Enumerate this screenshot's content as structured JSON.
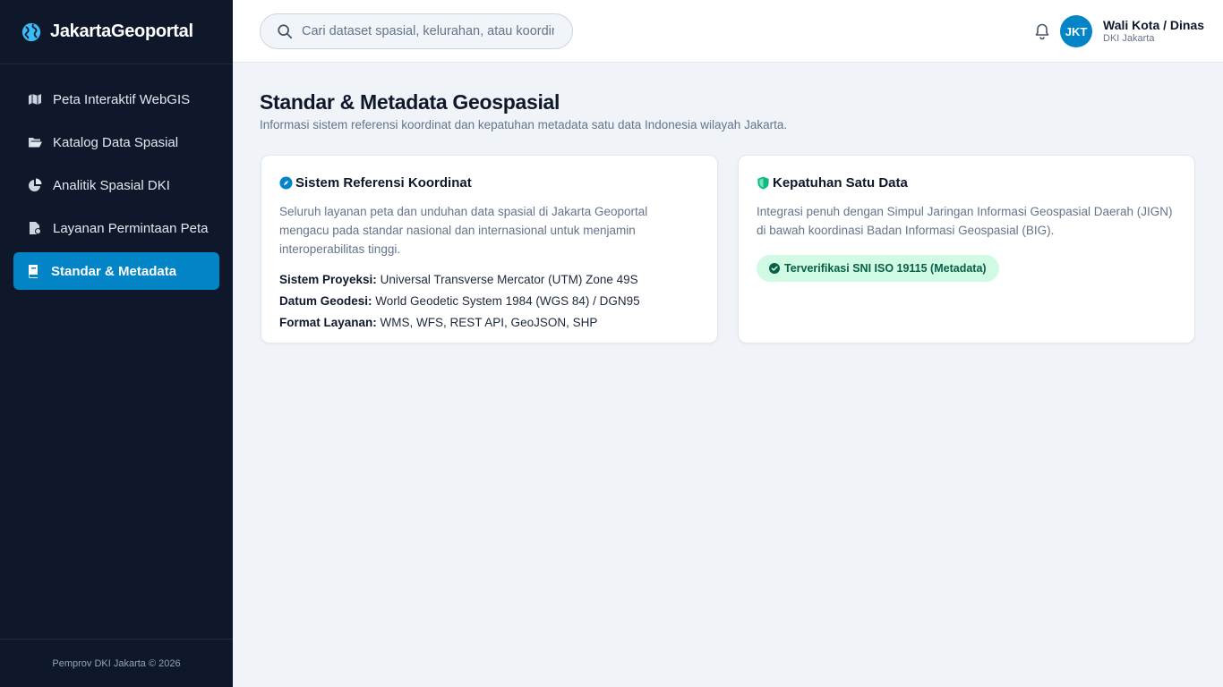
{
  "brand": {
    "name": "JakartaGeoportal",
    "icon": "globe-icon"
  },
  "sidebar": {
    "items": [
      {
        "label": "Peta Interaktif WebGIS",
        "icon": "map-icon",
        "active": false
      },
      {
        "label": "Katalog Data Spasial",
        "icon": "folder-open-icon",
        "active": false
      },
      {
        "label": "Analitik Spasial DKI",
        "icon": "pie-chart-icon",
        "active": false
      },
      {
        "label": "Layanan Permintaan Peta",
        "icon": "file-request-icon",
        "active": false
      },
      {
        "label": "Standar & Metadata",
        "icon": "book-icon",
        "active": true
      }
    ],
    "footer": "Pemprov DKI Jakarta © 2026"
  },
  "header": {
    "search_placeholder": "Cari dataset spasial, kelurahan, atau koordinat...",
    "user": {
      "initials": "JKT",
      "name": "Wali Kota / Dinas",
      "org": "DKI Jakarta"
    }
  },
  "main": {
    "title": "Standar & Metadata Geospasial",
    "subtitle": "Informasi sistem referensi koordinat dan kepatuhan metadata satu data Indonesia wilayah Jakarta.",
    "cards": {
      "crs": {
        "title": "Sistem Referensi Koordinat",
        "icon": "compass-icon",
        "description": "Seluruh layanan peta dan unduhan data spasial di Jakarta Geoportal mengacu pada standar nasional dan internasional untuk menjamin interoperabilitas tinggi.",
        "specs": [
          {
            "key": "Sistem Proyeksi:",
            "value": "Universal Transverse Mercator (UTM) Zone 49S"
          },
          {
            "key": "Datum Geodesi:",
            "value": "World Geodetic System 1984 (WGS 84) / DGN95"
          },
          {
            "key": "Format Layanan:",
            "value": "WMS, WFS, REST API, GeoJSON, SHP"
          }
        ]
      },
      "compliance": {
        "title": "Kepatuhan Satu Data",
        "icon": "shield-icon",
        "description": "Integrasi penuh dengan Simpul Jaringan Informasi Geospasial Daerah (JIGN) di bawah koordinasi Badan Informasi Geospasial (BIG).",
        "badge": "Terverifikasi SNI ISO 19115 (Metadata)"
      }
    }
  },
  "colors": {
    "sidebar_bg": "#0f172a",
    "accent": "#0284c7",
    "success": "#10b981",
    "badge_bg": "#d1fae5"
  }
}
